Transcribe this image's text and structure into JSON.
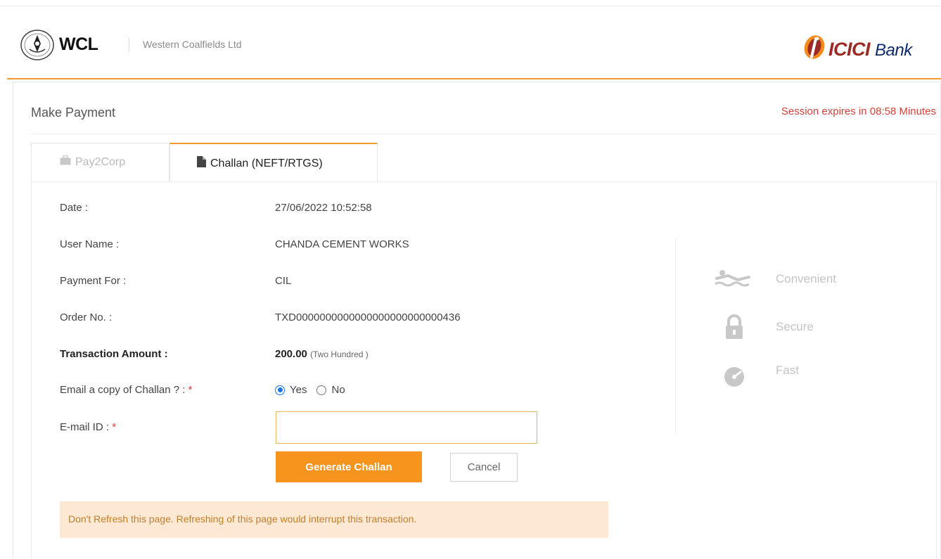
{
  "header": {
    "logo_text": "WCL",
    "company_name": "Western Coalfields Ltd",
    "bank_brand": "ICICI",
    "bank_suffix": "Bank"
  },
  "page": {
    "title": "Make Payment",
    "session_text": "Session expires in 08:58 Minutes"
  },
  "tabs": [
    {
      "label": "Pay2Corp",
      "active": false,
      "icon": "briefcase-icon"
    },
    {
      "label": "Challan (NEFT/RTGS)",
      "active": true,
      "icon": "document-icon"
    }
  ],
  "form": {
    "date_label": "Date :",
    "date_value": "27/06/2022 10:52:58",
    "user_label": "User Name :",
    "user_value": "CHANDA CEMENT WORKS",
    "payment_for_label": "Payment For :",
    "payment_for_value": "CIL",
    "order_label": "Order No. :",
    "order_value": "TXD0000000000000000000000000436",
    "amount_label": "Transaction Amount :",
    "amount_value": "200.00",
    "amount_words": "(Two Hundred )",
    "email_copy_label": "Email a copy of Challan ? :",
    "required_mark": "*",
    "radio_yes": "Yes",
    "radio_no": "No",
    "email_label": "E-mail ID :",
    "email_value": ""
  },
  "buttons": {
    "generate": "Generate Challan",
    "cancel": "Cancel"
  },
  "warning": "Don't Refresh this page. Refreshing of this page would interrupt this transaction.",
  "features": [
    {
      "label": "Convenient",
      "icon": "swimmer-icon"
    },
    {
      "label": "Secure",
      "icon": "lock-icon"
    },
    {
      "label": "Fast",
      "icon": "speedometer-icon"
    }
  ],
  "colors": {
    "accent": "#f7941d",
    "session_red": "#d6413a",
    "warning_bg": "#fde9d3",
    "icici_red": "#9b2a24",
    "icici_blue": "#0d2a6e"
  }
}
